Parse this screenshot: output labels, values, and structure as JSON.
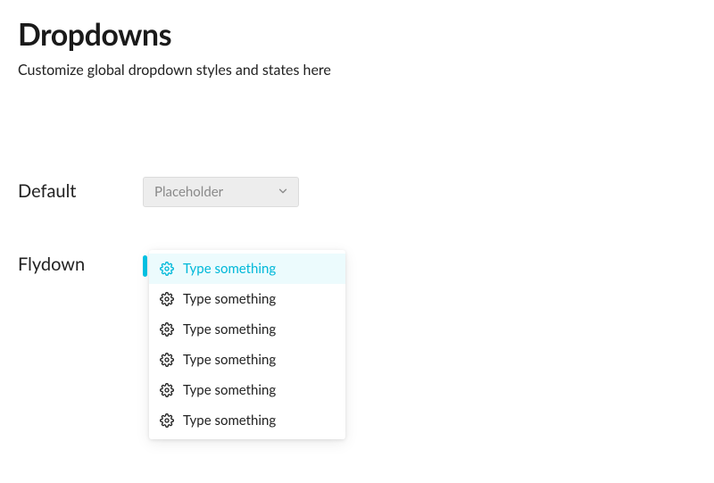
{
  "page": {
    "title": "Dropdowns",
    "subtitle": "Customize global dropdown styles and states here"
  },
  "sections": {
    "default": {
      "label": "Default",
      "select": {
        "placeholder": "Placeholder"
      }
    },
    "flydown": {
      "label": "Flydown",
      "items": [
        {
          "label": "Type something",
          "active": true
        },
        {
          "label": "Type something",
          "active": false
        },
        {
          "label": "Type something",
          "active": false
        },
        {
          "label": "Type something",
          "active": false
        },
        {
          "label": "Type something",
          "active": false
        },
        {
          "label": "Type something",
          "active": false
        }
      ]
    }
  },
  "colors": {
    "accent": "#00c4e6",
    "accent_text": "#00b8d9",
    "active_bg": "#ecfbfd"
  }
}
